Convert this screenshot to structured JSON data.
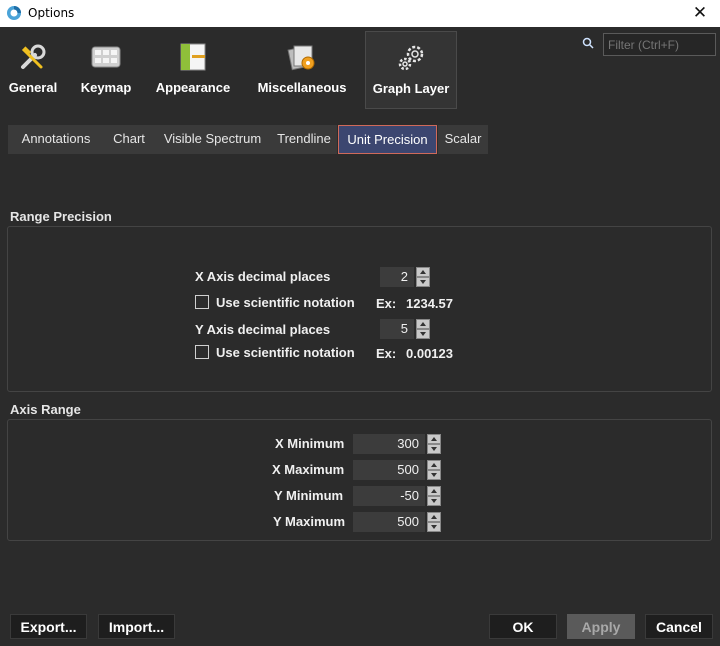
{
  "window": {
    "title": "Options"
  },
  "categories": [
    {
      "label": "General",
      "icon": "wrench-screwdriver-icon"
    },
    {
      "label": "Keymap",
      "icon": "keyboard-icon"
    },
    {
      "label": "Appearance",
      "icon": "layout-palette-icon"
    },
    {
      "label": "Miscellaneous",
      "icon": "cards-gear-icon"
    },
    {
      "label": "Graph Layer",
      "icon": "gears-icon",
      "active": true
    }
  ],
  "filter": {
    "placeholder": "Filter (Ctrl+F)"
  },
  "tabs": [
    {
      "label": "Annotations"
    },
    {
      "label": "Chart"
    },
    {
      "label": "Visible Spectrum"
    },
    {
      "label": "Trendline"
    },
    {
      "label": "Unit Precision",
      "active": true
    },
    {
      "label": "Scalar"
    }
  ],
  "range_precision": {
    "title": "Range Precision",
    "x_axis": {
      "label": "X Axis decimal places",
      "value": "2",
      "sci_label": "Use scientific notation",
      "sci_checked": false,
      "example_label": "Ex:",
      "example_value": "1234.57"
    },
    "y_axis": {
      "label": "Y Axis decimal places",
      "value": "5",
      "sci_label": "Use scientific notation",
      "sci_checked": false,
      "example_label": "Ex:",
      "example_value": "0.00123"
    }
  },
  "axis_range": {
    "title": "Axis Range",
    "fields": [
      {
        "label": "X Minimum",
        "value": "300"
      },
      {
        "label": "X Maximum",
        "value": "500"
      },
      {
        "label": "Y Minimum",
        "value": "-50"
      },
      {
        "label": "Y Maximum",
        "value": "500"
      }
    ]
  },
  "footer": {
    "export": "Export...",
    "import": "Import...",
    "ok": "OK",
    "apply": "Apply",
    "cancel": "Cancel"
  },
  "colors": {
    "background": "#2b2b2b",
    "active_tab": "#3c4670",
    "active_tab_border": "#d06a5a"
  }
}
